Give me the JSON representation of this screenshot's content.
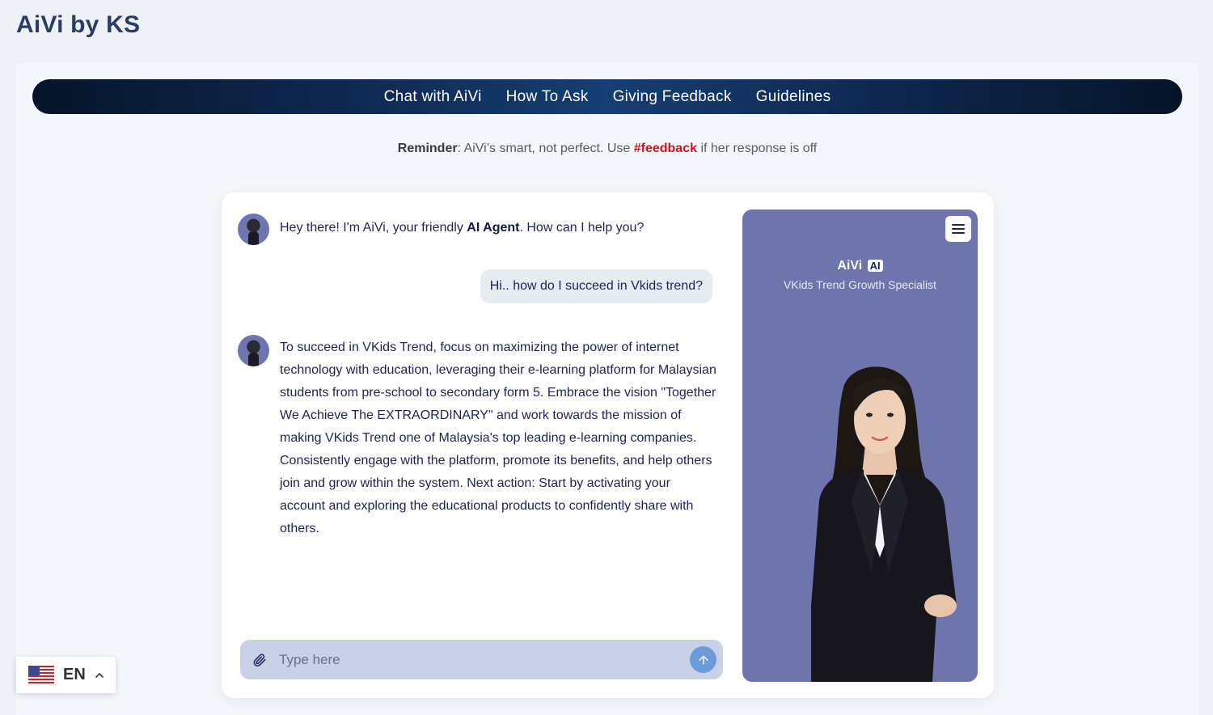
{
  "site": {
    "title": "AiVi by KS"
  },
  "nav": {
    "items": [
      "Chat with AiVi",
      "How To Ask",
      "Giving Feedback",
      "Guidelines"
    ]
  },
  "reminder": {
    "label": "Reminder",
    "text_before": ": AiVi’s smart, not perfect. Use ",
    "feedback_tag": "#feedback",
    "text_after": " if her response is off"
  },
  "chat": {
    "messages": [
      {
        "role": "bot",
        "before": "Hey there! I'm AiVi, your friendly ",
        "bold": "AI Agent",
        "after": ". How can I help you?"
      },
      {
        "role": "user",
        "text": "Hi.. how do I succeed in Vkids trend?"
      },
      {
        "role": "bot",
        "text": "To succeed in VKids Trend, focus on maximizing the power of internet technology with education, leveraging their e-learning platform for Malaysian students from pre-school to secondary form 5. Embrace the vision \"Together We Achieve The EXTRAORDINARY\" and work towards the mission of making VKids Trend one of Malaysia's top leading e-learning companies. Consistently engage with the platform, promote its benefits, and help others join and grow within the system. Next action: Start by activating your account and exploring the educational products to confidently share with others."
      }
    ],
    "input": {
      "placeholder": "Type here",
      "value": ""
    }
  },
  "profile": {
    "name": "AiVi",
    "badge": "AI",
    "role": "VKids Trend Growth Specialist"
  },
  "language": {
    "code": "EN"
  },
  "icons": {
    "attach": "paperclip-icon",
    "send": "arrow-up-icon",
    "menu": "hamburger-menu-icon",
    "flag": "us-flag-icon",
    "chevron": "chevron-up-icon"
  },
  "colors": {
    "nav_dark": "#061428",
    "nav_light": "#163e73",
    "feedback_red": "#c8171d",
    "profile_bg": "#6e74ac",
    "input_bg": "#c9d1e8",
    "send_button": "#6f9ad9"
  }
}
